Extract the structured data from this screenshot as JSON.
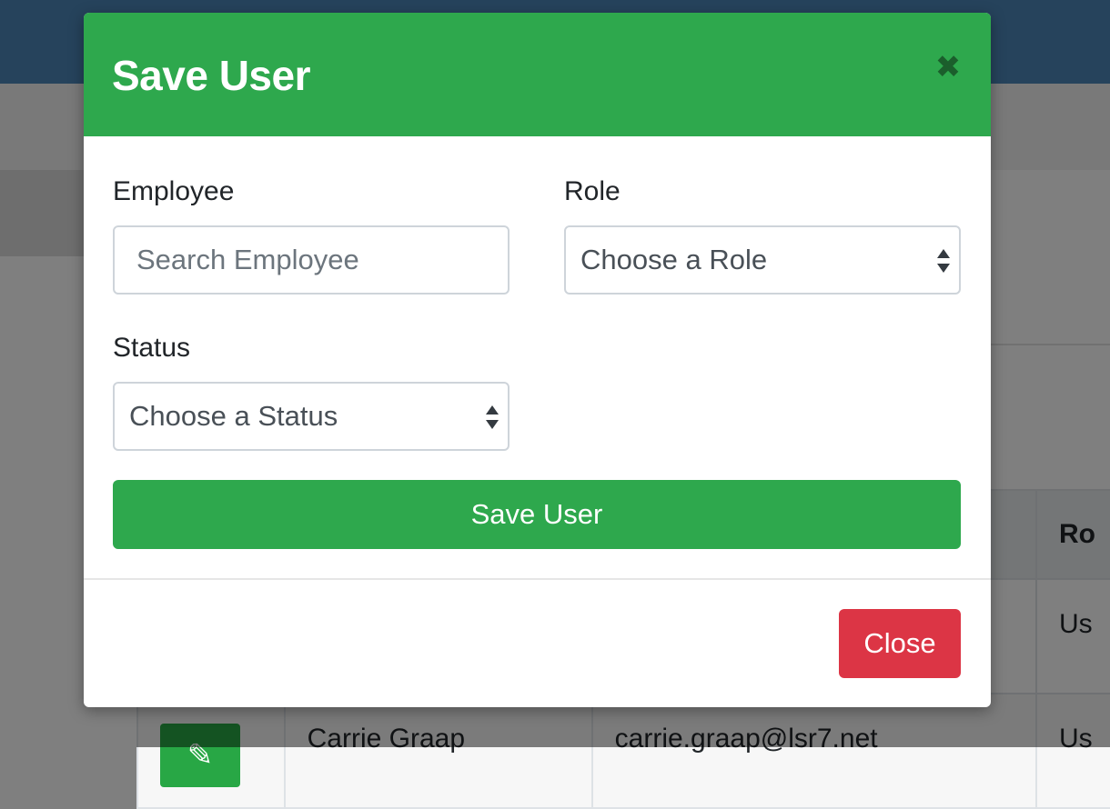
{
  "modal": {
    "title": "Save User",
    "close_icon": "close-icon",
    "employee_label": "Employee",
    "employee_placeholder": "Search Employee",
    "role_label": "Role",
    "role_value": "Choose a Role",
    "status_label": "Status",
    "status_value": "Choose a Status",
    "save_button": "Save User",
    "close_button": "Close"
  },
  "background_table": {
    "header_partial": "Ro",
    "row1_role_partial": "Us",
    "row2": {
      "name": "Carrie Graap",
      "email": "carrie.graap@lsr7.net",
      "role_partial": "Us"
    }
  },
  "colors": {
    "header_green": "#2ea84d",
    "save_green": "#2ea84d",
    "close_red": "#dc3545",
    "top_bar_blue": "#4d86b8"
  }
}
